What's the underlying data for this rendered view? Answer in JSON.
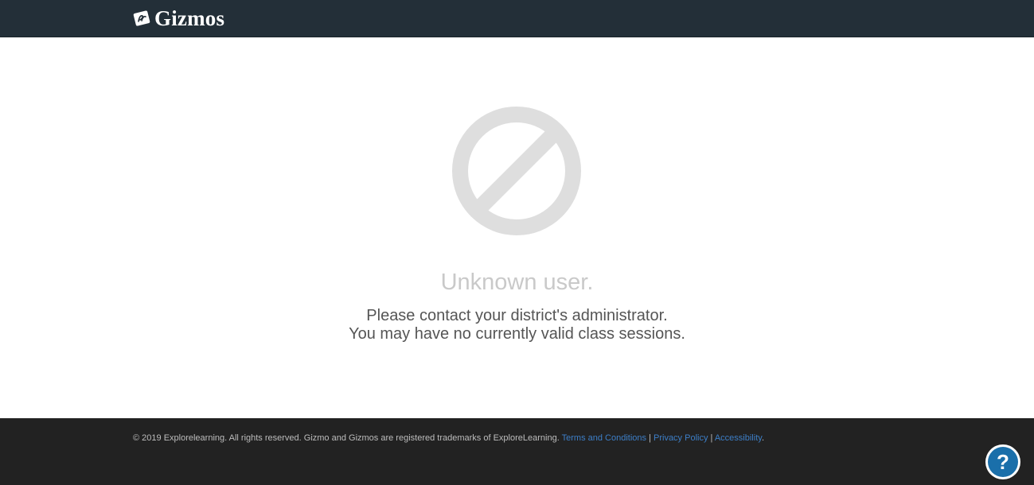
{
  "header": {
    "brand": "Gizmos",
    "logo_icon": "gizmos-logo-icon"
  },
  "main": {
    "icon": "blocked-icon",
    "title": "Unknown user.",
    "message_lines": [
      "Please contact your district's administrator.",
      "You may have no currently valid class sessions."
    ]
  },
  "footer": {
    "copyright": "© 2019 Explorelearning.  All rights reserved.  Gizmo and Gizmos are registered trademarks of ExploreLearning.",
    "links": [
      "Terms and Conditions",
      "Privacy Policy",
      "Accessibility"
    ],
    "separator": "|",
    "trailing": "."
  },
  "help": {
    "icon": "help-icon",
    "glyph": "?"
  },
  "colors": {
    "header_bg": "#232f38",
    "footer_bg": "#222222",
    "link": "#3d7fc8",
    "icon_gray": "#dedede",
    "help_blue": "#1a6faa"
  }
}
